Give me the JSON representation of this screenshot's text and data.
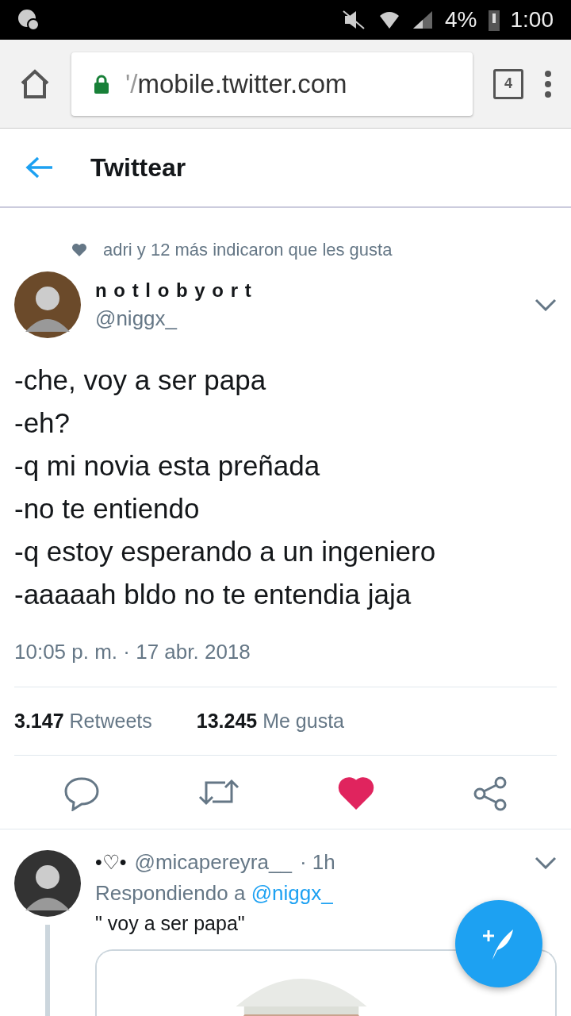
{
  "status_bar": {
    "battery": "4%",
    "time": "1:00"
  },
  "browser": {
    "url_faded": "'/",
    "url": "mobile.twitter.com",
    "tab_count": "4"
  },
  "header": {
    "title": "Twittear"
  },
  "tweet": {
    "social_context": "adri y 12 más indicaron que les gusta",
    "name": "n o t l o b y o r t",
    "handle": "@niggx_",
    "lines": [
      "-che, voy a ser papa",
      "-eh?",
      "-q mi novia esta preñada",
      "-no te entiendo",
      "-q estoy esperando a un ingeniero",
      "-aaaaah bldo no te entendia jaja"
    ],
    "timestamp": "10:05 p. m. · 17 abr. 2018",
    "stats": [
      {
        "count": "3.147",
        "label": "Retweets"
      },
      {
        "count": "13.245",
        "label": "Me gusta"
      }
    ],
    "liked": true
  },
  "reply": {
    "name": "•♡•",
    "handle": "@micapereyra__",
    "time": "· 1h",
    "replying_prefix": "Respondiendo a",
    "replying_to": "@niggx_",
    "text": "\" voy a ser papa\""
  }
}
